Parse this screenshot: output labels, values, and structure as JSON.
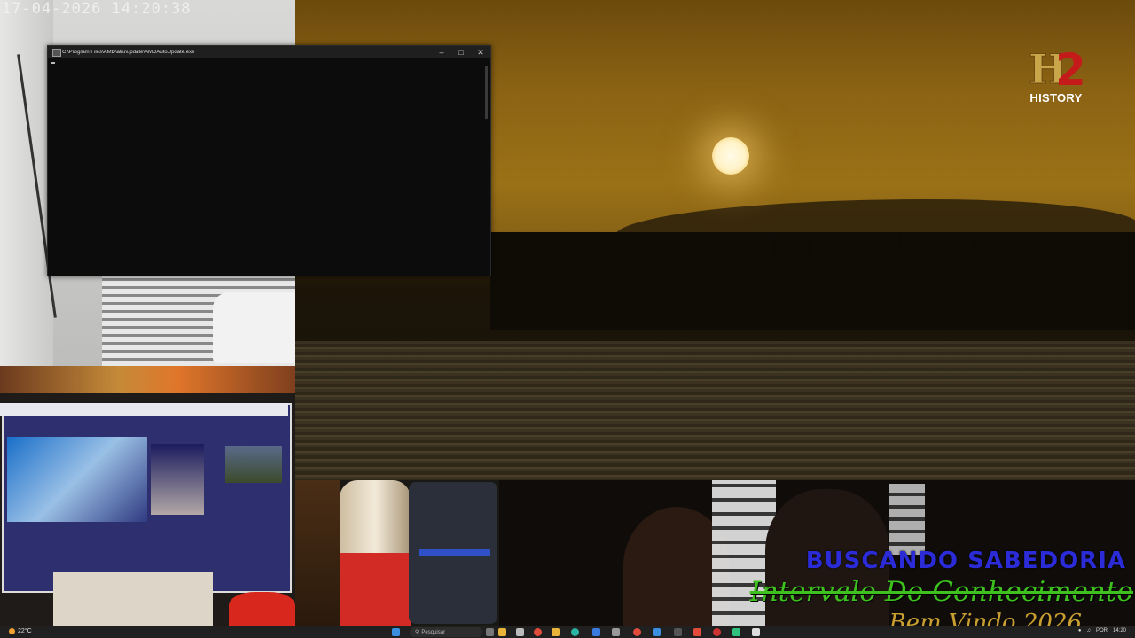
{
  "camera": {
    "timestamp": "17-04-2026 14:20:38"
  },
  "terminal": {
    "title": "C:\\Program Files\\AMD\\atiu\\update\\AMDAutoUpdate.exe",
    "minimize_icon": "minimize-icon",
    "maximize_icon": "maximize-icon",
    "close_icon": "close-icon"
  },
  "broadcast": {
    "channel_logo_text": "H2",
    "channel_name": "HISTORY"
  },
  "overlay": {
    "line1": "BUSCANDO SABEDORIA",
    "line2": "Intervalo Do Conhecimento",
    "line3": "Bem Vindo 2026"
  },
  "taskbar": {
    "weather": "22°C",
    "search_placeholder": "Pesquisar",
    "tray_lang": "POR",
    "tray_time": "14:20",
    "icons": [
      "start-icon",
      "task-view-icon",
      "explorer-icon",
      "chrome-icon",
      "folder-icon",
      "edge-icon",
      "store-icon",
      "chrome-icon-2",
      "settings-icon",
      "app-icon",
      "media-icon",
      "terminal-icon"
    ],
    "colors": {
      "start": "#3b8fe0",
      "chrome": "#e04b3b",
      "folder": "#e8b53a",
      "edge": "#2ab4a4",
      "store": "#3a7be0",
      "green": "#2ec27e"
    }
  }
}
